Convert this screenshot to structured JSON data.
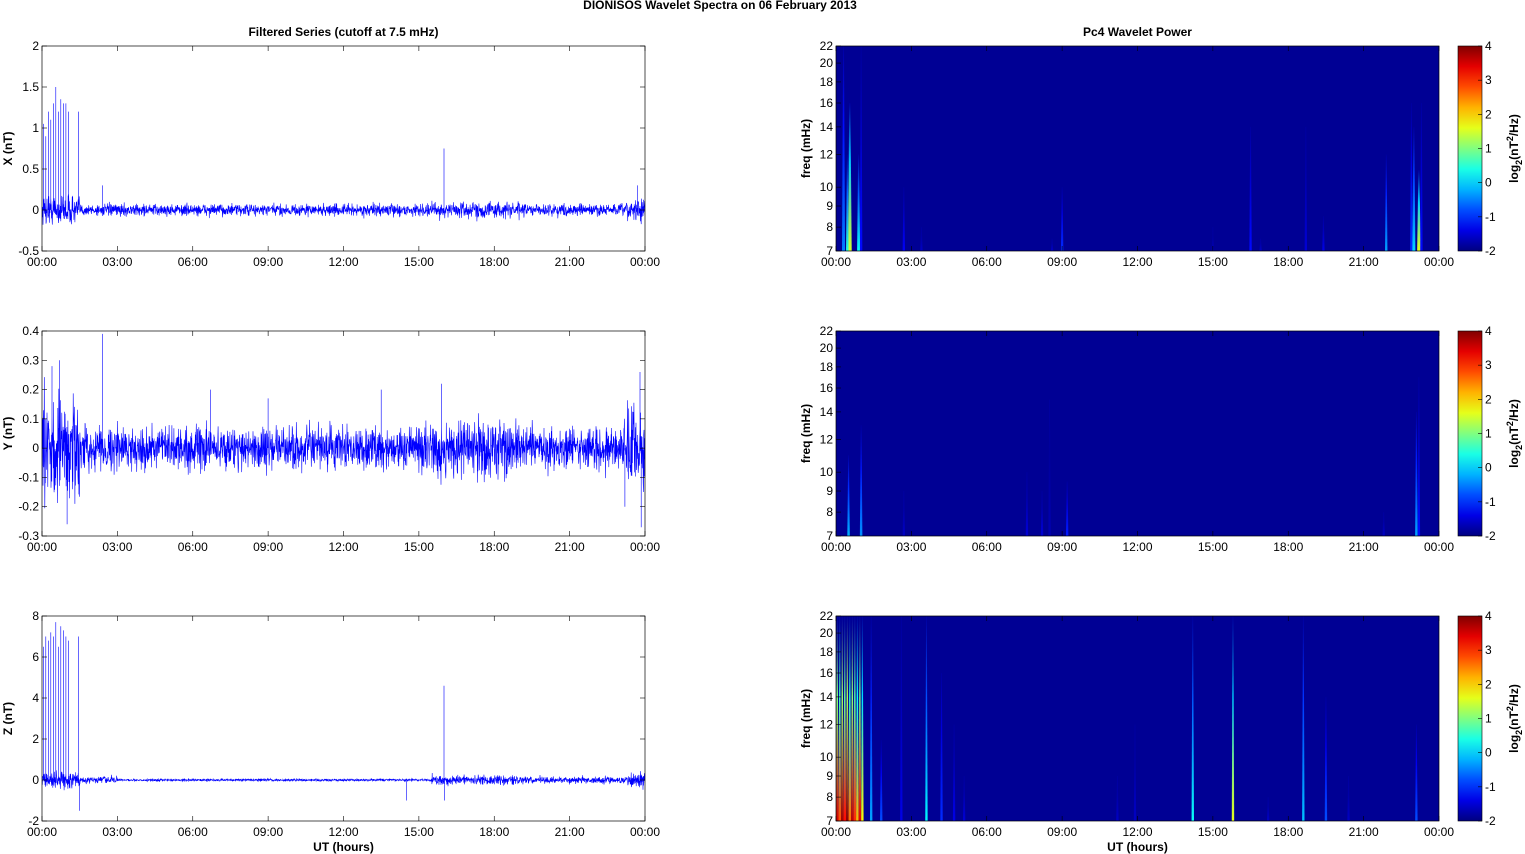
{
  "title": "DIONISOS Wavelet Spectra on 06 February  2013",
  "chart_data": [
    {
      "type": "line",
      "panel": "X",
      "title": "Filtered Series (cutoff at 7.5 mHz)",
      "xlabel": "",
      "ylabel": "X (nT)",
      "xlim": [
        0,
        24
      ],
      "ylim": [
        -0.5,
        2
      ],
      "xticks": [
        "00:00",
        "03:00",
        "06:00",
        "09:00",
        "12:00",
        "15:00",
        "18:00",
        "21:00",
        "00:00"
      ],
      "yticks": [
        -0.5,
        0,
        0.5,
        1,
        1.5,
        2
      ],
      "series_color": "#0000ff",
      "noise_amplitude": 0.05,
      "spikes": [
        [
          0.05,
          1.05
        ],
        [
          0.15,
          0.9
        ],
        [
          0.25,
          1.2
        ],
        [
          0.35,
          1.1
        ],
        [
          0.45,
          1.3
        ],
        [
          0.55,
          1.5
        ],
        [
          0.65,
          1.2
        ],
        [
          0.75,
          1.35
        ],
        [
          0.85,
          1.3
        ],
        [
          0.95,
          1.3
        ],
        [
          1.05,
          1.2
        ],
        [
          1.45,
          1.2
        ],
        [
          2.4,
          0.3
        ],
        [
          16.0,
          0.75
        ],
        [
          23.7,
          0.3
        ]
      ]
    },
    {
      "type": "line",
      "panel": "Y",
      "xlabel": "",
      "ylabel": "Y (nT)",
      "xlim": [
        0,
        24
      ],
      "ylim": [
        -0.3,
        0.4
      ],
      "xticks": [
        "00:00",
        "03:00",
        "06:00",
        "09:00",
        "12:00",
        "15:00",
        "18:00",
        "21:00",
        "00:00"
      ],
      "yticks": [
        -0.3,
        -0.2,
        -0.1,
        0,
        0.1,
        0.2,
        0.3,
        0.4
      ],
      "series_color": "#0000ff",
      "noise_amplitude": 0.05,
      "spikes": [
        [
          0.4,
          0.28
        ],
        [
          0.7,
          0.3
        ],
        [
          1.0,
          -0.26
        ],
        [
          2.4,
          0.39
        ],
        [
          6.7,
          0.2
        ],
        [
          9.0,
          0.17
        ],
        [
          13.5,
          0.2
        ],
        [
          15.9,
          0.22
        ],
        [
          23.2,
          -0.2
        ],
        [
          23.8,
          0.26
        ],
        [
          23.85,
          -0.27
        ]
      ]
    },
    {
      "type": "line",
      "panel": "Z",
      "xlabel": "UT (hours)",
      "ylabel": "Z (nT)",
      "xlim": [
        0,
        24
      ],
      "ylim": [
        -2,
        8
      ],
      "xticks": [
        "00:00",
        "03:00",
        "06:00",
        "09:00",
        "12:00",
        "15:00",
        "18:00",
        "21:00",
        "00:00"
      ],
      "yticks": [
        -2,
        0,
        2,
        4,
        6,
        8
      ],
      "series_color": "#0000ff",
      "noise_amplitude": 0.12,
      "spikes": [
        [
          0.05,
          6.5
        ],
        [
          0.15,
          7.0
        ],
        [
          0.25,
          6.8
        ],
        [
          0.35,
          7.2
        ],
        [
          0.45,
          7.0
        ],
        [
          0.55,
          7.7
        ],
        [
          0.65,
          6.5
        ],
        [
          0.75,
          7.5
        ],
        [
          0.85,
          7.3
        ],
        [
          0.95,
          7.0
        ],
        [
          1.05,
          6.8
        ],
        [
          1.45,
          7.0
        ],
        [
          1.5,
          -1.5
        ],
        [
          14.5,
          -1.0
        ],
        [
          16.0,
          4.6
        ],
        [
          16.02,
          -1.0
        ]
      ]
    },
    {
      "type": "heatmap",
      "panel": "X",
      "title": "Pc4 Wavelet Power",
      "xlabel": "",
      "ylabel": "freq (mHz)",
      "xlim": [
        0,
        24
      ],
      "ylim": [
        7,
        22
      ],
      "yscale": "log",
      "xticks": [
        "00:00",
        "03:00",
        "06:00",
        "09:00",
        "12:00",
        "15:00",
        "18:00",
        "21:00",
        "00:00"
      ],
      "yticks": [
        7,
        8,
        9,
        10,
        12,
        14,
        16,
        18,
        20,
        22
      ],
      "colorbar": {
        "label": "log2(nT^2/Hz)",
        "range": [
          -2,
          4
        ],
        "ticks": [
          -2,
          -1,
          0,
          1,
          2,
          3,
          4
        ],
        "colormap": "jet"
      },
      "bursts": [
        [
          0.3,
          0.12,
          22,
          -0.5
        ],
        [
          0.55,
          0.15,
          16,
          1.5
        ],
        [
          0.45,
          0.1,
          12,
          0.5
        ],
        [
          0.9,
          0.12,
          12,
          0.3
        ],
        [
          1.0,
          0.06,
          22,
          -1.2
        ],
        [
          2.7,
          0.06,
          10,
          -1.3
        ],
        [
          3.4,
          0.05,
          8,
          -1.6
        ],
        [
          9.0,
          0.07,
          10,
          -1.0
        ],
        [
          8.6,
          0.05,
          7.5,
          -1.6
        ],
        [
          15.0,
          0.05,
          8,
          -1.7
        ],
        [
          16.5,
          0.06,
          14,
          -1.2
        ],
        [
          16.9,
          0.05,
          7.5,
          -1.6
        ],
        [
          18.7,
          0.04,
          14,
          -1.5
        ],
        [
          19.4,
          0.05,
          8.5,
          -1.4
        ],
        [
          21.9,
          0.08,
          12,
          -0.3
        ],
        [
          22.9,
          0.06,
          16,
          -1.0
        ],
        [
          23.0,
          0.12,
          14,
          0.0
        ],
        [
          23.2,
          0.14,
          11,
          1.6
        ],
        [
          23.3,
          0.06,
          16,
          -1.2
        ]
      ]
    },
    {
      "type": "heatmap",
      "panel": "Y",
      "xlabel": "",
      "ylabel": "freq (mHz)",
      "xlim": [
        0,
        24
      ],
      "ylim": [
        7,
        22
      ],
      "yscale": "log",
      "xticks": [
        "00:00",
        "03:00",
        "06:00",
        "09:00",
        "12:00",
        "15:00",
        "18:00",
        "21:00",
        "00:00"
      ],
      "yticks": [
        7,
        8,
        9,
        10,
        12,
        14,
        16,
        18,
        20,
        22
      ],
      "colorbar": {
        "label": "log2(nT^2/Hz)",
        "range": [
          -2,
          4
        ],
        "ticks": [
          -2,
          -1,
          0,
          1,
          2,
          3,
          4
        ],
        "colormap": "jet"
      },
      "bursts": [
        [
          0.5,
          0.1,
          11,
          -0.2
        ],
        [
          1.0,
          0.1,
          13,
          -0.4
        ],
        [
          2.7,
          0.05,
          9,
          -1.6
        ],
        [
          7.6,
          0.05,
          10,
          -1.5
        ],
        [
          8.2,
          0.05,
          9,
          -1.5
        ],
        [
          8.5,
          0.04,
          15,
          -1.7
        ],
        [
          9.2,
          0.06,
          9.5,
          -1.1
        ],
        [
          21.8,
          0.05,
          8,
          -1.6
        ],
        [
          23.1,
          0.1,
          14,
          -0.3
        ],
        [
          23.2,
          0.06,
          17,
          -1.2
        ]
      ]
    },
    {
      "type": "heatmap",
      "panel": "Z",
      "xlabel": "UT (hours)",
      "ylabel": "freq (mHz)",
      "xlim": [
        0,
        24
      ],
      "ylim": [
        7,
        22
      ],
      "yscale": "log",
      "xticks": [
        "00:00",
        "03:00",
        "06:00",
        "09:00",
        "12:00",
        "15:00",
        "18:00",
        "21:00",
        "00:00"
      ],
      "yticks": [
        7,
        8,
        9,
        10,
        12,
        14,
        16,
        18,
        20,
        22
      ],
      "colorbar": {
        "label": "log2(nT^2/Hz)",
        "range": [
          -2,
          4
        ],
        "ticks": [
          -2,
          -1,
          0,
          1,
          2,
          3,
          4
        ],
        "colormap": "jet"
      },
      "bursts": [
        [
          0.05,
          0.1,
          22,
          3.5
        ],
        [
          0.15,
          0.1,
          22,
          2.8
        ],
        [
          0.25,
          0.1,
          22,
          3.8
        ],
        [
          0.35,
          0.1,
          22,
          3.2
        ],
        [
          0.45,
          0.1,
          22,
          3.9
        ],
        [
          0.55,
          0.1,
          22,
          2.6
        ],
        [
          0.65,
          0.1,
          22,
          3.6
        ],
        [
          0.75,
          0.1,
          22,
          3.0
        ],
        [
          0.85,
          0.1,
          22,
          2.2
        ],
        [
          0.95,
          0.1,
          22,
          3.4
        ],
        [
          1.05,
          0.08,
          22,
          1.8
        ],
        [
          1.4,
          0.05,
          22,
          -0.3
        ],
        [
          1.8,
          0.06,
          11,
          -0.8
        ],
        [
          2.6,
          0.04,
          22,
          -1.4
        ],
        [
          3.6,
          0.07,
          22,
          0.2
        ],
        [
          4.2,
          0.05,
          16,
          -1.0
        ],
        [
          4.7,
          0.04,
          12,
          -1.4
        ],
        [
          5.1,
          0.04,
          9,
          -1.5
        ],
        [
          11.2,
          0.04,
          9,
          -1.6
        ],
        [
          11.9,
          0.04,
          12,
          -1.6
        ],
        [
          14.2,
          0.05,
          22,
          0.3
        ],
        [
          15.8,
          0.06,
          22,
          1.6
        ],
        [
          17.2,
          0.04,
          8,
          -1.6
        ],
        [
          18.6,
          0.05,
          22,
          -0.1
        ],
        [
          19.5,
          0.06,
          14,
          -0.8
        ],
        [
          20.4,
          0.04,
          9,
          -1.6
        ],
        [
          23.1,
          0.06,
          12,
          -0.8
        ]
      ]
    }
  ]
}
